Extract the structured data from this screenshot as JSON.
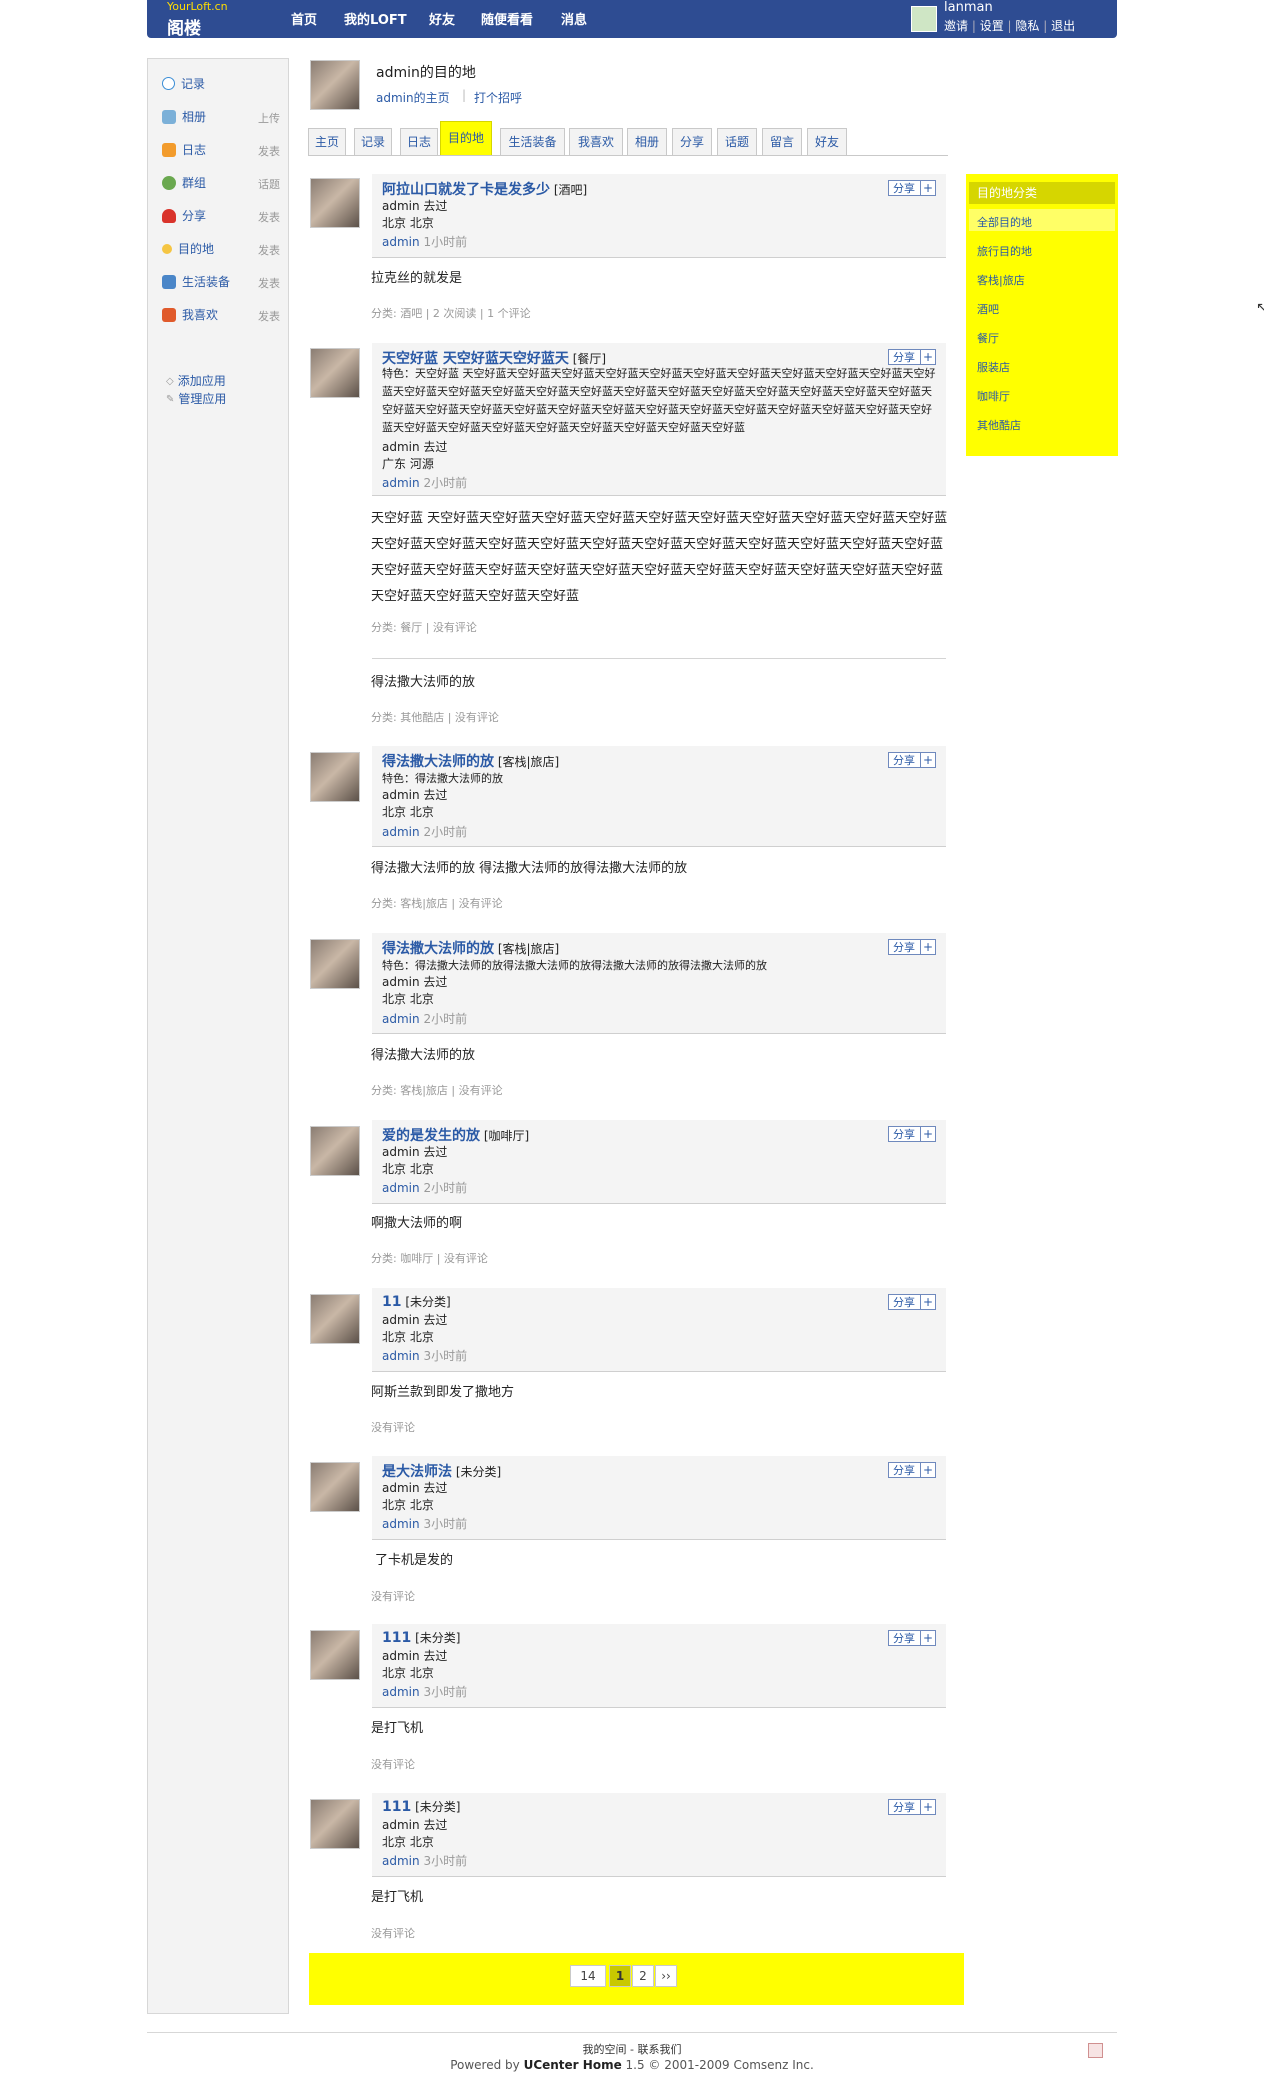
{
  "header": {
    "logo_en": "YourLoft.cn",
    "logo_cn": "阁楼",
    "nav": [
      "首页",
      "我的LOFT",
      "好友",
      "随便看看",
      "消息"
    ],
    "username": "lanman",
    "user_links": [
      "邀请",
      "设置",
      "隐私",
      "退出"
    ]
  },
  "sidebar": {
    "items": [
      {
        "label": "记录",
        "action": ""
      },
      {
        "label": "相册",
        "action": "上传"
      },
      {
        "label": "日志",
        "action": "发表"
      },
      {
        "label": "群组",
        "action": "话题"
      },
      {
        "label": "分享",
        "action": "发表"
      },
      {
        "label": "目的地",
        "action": "发表"
      },
      {
        "label": "生活装备",
        "action": "发表"
      },
      {
        "label": "我喜欢",
        "action": "发表"
      }
    ],
    "apps": [
      "添加应用",
      "管理应用"
    ]
  },
  "page": {
    "title": "admin的目的地",
    "home_link": "admin的主页",
    "greet_link": "打个招呼",
    "tabs": [
      "主页",
      "记录",
      "日志",
      "目的地",
      "生活装备",
      "我喜欢",
      "相册",
      "分享",
      "话题",
      "留言",
      "好友"
    ]
  },
  "posts": [
    {
      "title": "阿拉山口就发了卡是发多少",
      "cat": "[酒吧]",
      "feature": "",
      "who": "admin 去过",
      "place": "北京 北京",
      "author": "admin",
      "time": "1小时前",
      "body": "拉克丝的就发是",
      "foot": "分类: 酒吧 | 2 次阅读 | 1 个评论"
    },
    {
      "title": "天空好蓝 天空好蓝天空好蓝天",
      "cat": "[餐厅]",
      "feature": "特色：天空好蓝 天空好蓝天空好蓝天空好蓝天空好蓝天空好蓝天空好蓝天空好蓝天空好蓝天空好蓝天空好蓝天空好蓝天空好蓝天空好蓝天空好蓝天空好蓝天空好蓝天空好蓝天空好蓝天空好蓝天空好蓝天空好蓝天空好蓝天空好蓝天空好蓝天空好蓝天空好蓝天空好蓝天空好蓝天空好蓝天空好蓝天空好蓝天空好蓝天空好蓝天空好蓝天空好蓝天空好蓝天空好蓝天空好蓝天空好蓝天空好蓝天空好蓝天空好蓝天空好蓝天空好蓝",
      "who": "admin 去过",
      "place": "广东 河源",
      "author": "admin",
      "time": "2小时前",
      "body": "天空好蓝 天空好蓝天空好蓝天空好蓝天空好蓝天空好蓝天空好蓝天空好蓝天空好蓝天空好蓝天空好蓝天空好蓝天空好蓝天空好蓝天空好蓝天空好蓝天空好蓝天空好蓝天空好蓝天空好蓝天空好蓝天空好蓝天空好蓝天空好蓝天空好蓝天空好蓝天空好蓝天空好蓝天空好蓝天空好蓝天空好蓝天空好蓝天空好蓝天空好蓝天空好蓝天空好蓝天空好蓝",
      "foot": "分类: 餐厅 | 没有评论"
    },
    {
      "body": "得法撒大法师的放",
      "foot": "分类: 其他酷店 | 没有评论"
    },
    {
      "title": "得法撒大法师的放",
      "cat": "[客栈|旅店]",
      "feature": "特色：得法撒大法师的放",
      "who": "admin 去过",
      "place": "北京 北京",
      "author": "admin",
      "time": "2小时前",
      "body": "得法撒大法师的放 得法撒大法师的放得法撒大法师的放",
      "foot": "分类: 客栈|旅店 | 没有评论"
    },
    {
      "title": "得法撒大法师的放",
      "cat": "[客栈|旅店]",
      "feature": "特色：得法撒大法师的放得法撒大法师的放得法撒大法师的放得法撒大法师的放",
      "who": "admin 去过",
      "place": "北京 北京",
      "author": "admin",
      "time": "2小时前",
      "body": "得法撒大法师的放",
      "foot": "分类: 客栈|旅店 | 没有评论"
    },
    {
      "title": "爱的是发生的放",
      "cat": "[咖啡厅]",
      "feature": "",
      "who": "admin 去过",
      "place": "北京 北京",
      "author": "admin",
      "time": "2小时前",
      "body": "啊撒大法师的啊",
      "foot": "分类: 咖啡厅 | 没有评论"
    },
    {
      "title": "11",
      "cat": "[未分类]",
      "feature": "",
      "who": "admin 去过",
      "place": "北京 北京",
      "author": "admin",
      "time": "3小时前",
      "body": "阿斯兰款到即发了撒地方",
      "foot": "没有评论"
    },
    {
      "title": "是大法师法",
      "cat": "[未分类]",
      "feature": "",
      "who": "admin 去过",
      "place": "北京 北京",
      "author": "admin",
      "time": "3小时前",
      "body": "了卡机是发的",
      "foot": "没有评论"
    },
    {
      "title": "111",
      "cat": "[未分类]",
      "feature": "",
      "who": "admin 去过",
      "place": "北京 北京",
      "author": "admin",
      "time": "3小时前",
      "body": "是打飞机",
      "foot": "没有评论"
    },
    {
      "title": "111",
      "cat": "[未分类]",
      "feature": "",
      "who": "admin 去过",
      "place": "北京 北京",
      "author": "admin",
      "time": "3小时前",
      "body": "是打飞机",
      "foot": "没有评论"
    }
  ],
  "share_label": "分享",
  "share_plus": "+",
  "category_box": {
    "title": "目的地分类",
    "items": [
      "全部目的地",
      "旅行目的地",
      "客栈|旅店",
      "酒吧",
      "餐厅",
      "服装店",
      "咖啡厅",
      "其他酷店"
    ]
  },
  "pager": {
    "total": "14",
    "pages": [
      "1",
      "2"
    ],
    "next": "››"
  },
  "footer": {
    "links": "我的空间 - 联系我们",
    "powered_prefix": "Powered by ",
    "powered_brand": "UCenter Home",
    "powered_suffix": " 1.5 © 2001-2009 Comsenz Inc."
  },
  "colors": {
    "accent_yellow": "#ffff00",
    "header_blue": "#2e4c92",
    "link_blue": "#2b5aa6"
  }
}
